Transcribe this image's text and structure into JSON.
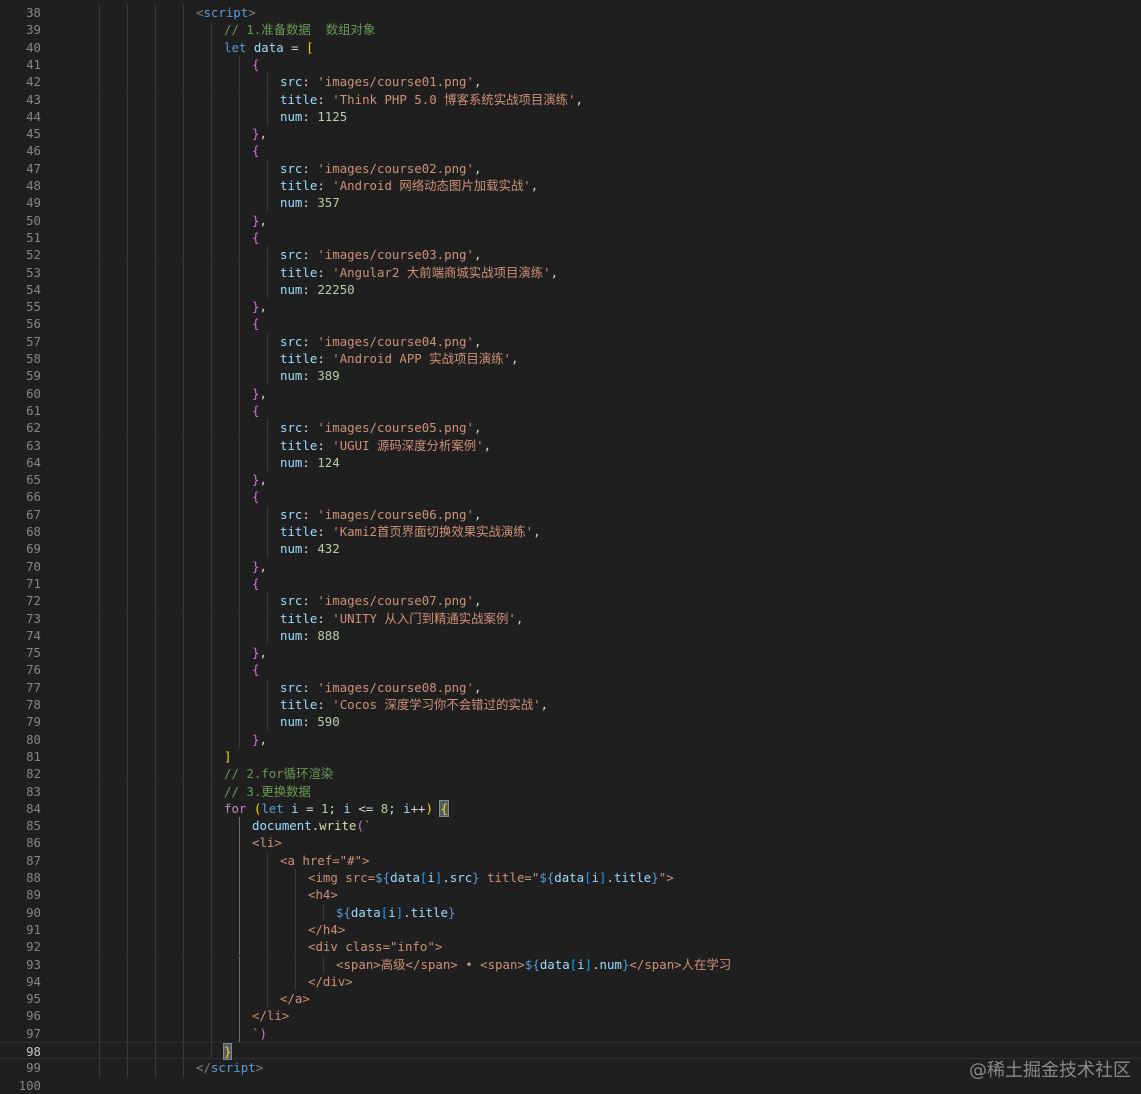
{
  "editor": {
    "lines": [
      {
        "num": "38",
        "indent": 4,
        "tokens": [
          [
            "tag",
            "<"
          ],
          [
            "tagname",
            "script"
          ],
          [
            "tag",
            ">"
          ]
        ]
      },
      {
        "num": "39",
        "indent": 5,
        "tokens": [
          [
            "cmt",
            "// 1.准备数据  数组对象"
          ]
        ]
      },
      {
        "num": "40",
        "indent": 5,
        "tokens": [
          [
            "kw",
            "let "
          ],
          [
            "var",
            "data"
          ],
          [
            "punc",
            " = "
          ],
          [
            "b1",
            "["
          ]
        ]
      },
      {
        "num": "41",
        "indent": 6,
        "tokens": [
          [
            "b2",
            "{"
          ]
        ]
      },
      {
        "num": "42",
        "indent": 7,
        "tokens": [
          [
            "prop",
            "src"
          ],
          [
            "punc",
            ": "
          ],
          [
            "str",
            "'images/course01.png'"
          ],
          [
            "punc",
            ","
          ]
        ]
      },
      {
        "num": "43",
        "indent": 7,
        "tokens": [
          [
            "prop",
            "title"
          ],
          [
            "punc",
            ": "
          ],
          [
            "str",
            "'Think PHP 5.0 博客系统实战项目演练'"
          ],
          [
            "punc",
            ","
          ]
        ]
      },
      {
        "num": "44",
        "indent": 7,
        "tokens": [
          [
            "prop",
            "num"
          ],
          [
            "punc",
            ": "
          ],
          [
            "num",
            "1125"
          ]
        ]
      },
      {
        "num": "45",
        "indent": 6,
        "tokens": [
          [
            "b2",
            "}"
          ],
          [
            "punc",
            ","
          ]
        ]
      },
      {
        "num": "46",
        "indent": 6,
        "tokens": [
          [
            "b2",
            "{"
          ]
        ]
      },
      {
        "num": "47",
        "indent": 7,
        "tokens": [
          [
            "prop",
            "src"
          ],
          [
            "punc",
            ": "
          ],
          [
            "str",
            "'images/course02.png'"
          ],
          [
            "punc",
            ","
          ]
        ]
      },
      {
        "num": "48",
        "indent": 7,
        "tokens": [
          [
            "prop",
            "title"
          ],
          [
            "punc",
            ": "
          ],
          [
            "str",
            "'Android 网络动态图片加载实战'"
          ],
          [
            "punc",
            ","
          ]
        ]
      },
      {
        "num": "49",
        "indent": 7,
        "tokens": [
          [
            "prop",
            "num"
          ],
          [
            "punc",
            ": "
          ],
          [
            "num",
            "357"
          ]
        ]
      },
      {
        "num": "50",
        "indent": 6,
        "tokens": [
          [
            "b2",
            "}"
          ],
          [
            "punc",
            ","
          ]
        ]
      },
      {
        "num": "51",
        "indent": 6,
        "tokens": [
          [
            "b2",
            "{"
          ]
        ]
      },
      {
        "num": "52",
        "indent": 7,
        "tokens": [
          [
            "prop",
            "src"
          ],
          [
            "punc",
            ": "
          ],
          [
            "str",
            "'images/course03.png'"
          ],
          [
            "punc",
            ","
          ]
        ]
      },
      {
        "num": "53",
        "indent": 7,
        "tokens": [
          [
            "prop",
            "title"
          ],
          [
            "punc",
            ": "
          ],
          [
            "str",
            "'Angular2 大前端商城实战项目演练'"
          ],
          [
            "punc",
            ","
          ]
        ]
      },
      {
        "num": "54",
        "indent": 7,
        "tokens": [
          [
            "prop",
            "num"
          ],
          [
            "punc",
            ": "
          ],
          [
            "num",
            "22250"
          ]
        ]
      },
      {
        "num": "55",
        "indent": 6,
        "tokens": [
          [
            "b2",
            "}"
          ],
          [
            "punc",
            ","
          ]
        ]
      },
      {
        "num": "56",
        "indent": 6,
        "tokens": [
          [
            "b2",
            "{"
          ]
        ]
      },
      {
        "num": "57",
        "indent": 7,
        "tokens": [
          [
            "prop",
            "src"
          ],
          [
            "punc",
            ": "
          ],
          [
            "str",
            "'images/course04.png'"
          ],
          [
            "punc",
            ","
          ]
        ]
      },
      {
        "num": "58",
        "indent": 7,
        "tokens": [
          [
            "prop",
            "title"
          ],
          [
            "punc",
            ": "
          ],
          [
            "str",
            "'Android APP 实战项目演练'"
          ],
          [
            "punc",
            ","
          ]
        ]
      },
      {
        "num": "59",
        "indent": 7,
        "tokens": [
          [
            "prop",
            "num"
          ],
          [
            "punc",
            ": "
          ],
          [
            "num",
            "389"
          ]
        ]
      },
      {
        "num": "60",
        "indent": 6,
        "tokens": [
          [
            "b2",
            "}"
          ],
          [
            "punc",
            ","
          ]
        ]
      },
      {
        "num": "61",
        "indent": 6,
        "tokens": [
          [
            "b2",
            "{"
          ]
        ]
      },
      {
        "num": "62",
        "indent": 7,
        "tokens": [
          [
            "prop",
            "src"
          ],
          [
            "punc",
            ": "
          ],
          [
            "str",
            "'images/course05.png'"
          ],
          [
            "punc",
            ","
          ]
        ]
      },
      {
        "num": "63",
        "indent": 7,
        "tokens": [
          [
            "prop",
            "title"
          ],
          [
            "punc",
            ": "
          ],
          [
            "str",
            "'UGUI 源码深度分析案例'"
          ],
          [
            "punc",
            ","
          ]
        ]
      },
      {
        "num": "64",
        "indent": 7,
        "tokens": [
          [
            "prop",
            "num"
          ],
          [
            "punc",
            ": "
          ],
          [
            "num",
            "124"
          ]
        ]
      },
      {
        "num": "65",
        "indent": 6,
        "tokens": [
          [
            "b2",
            "}"
          ],
          [
            "punc",
            ","
          ]
        ]
      },
      {
        "num": "66",
        "indent": 6,
        "tokens": [
          [
            "b2",
            "{"
          ]
        ]
      },
      {
        "num": "67",
        "indent": 7,
        "tokens": [
          [
            "prop",
            "src"
          ],
          [
            "punc",
            ": "
          ],
          [
            "str",
            "'images/course06.png'"
          ],
          [
            "punc",
            ","
          ]
        ]
      },
      {
        "num": "68",
        "indent": 7,
        "tokens": [
          [
            "prop",
            "title"
          ],
          [
            "punc",
            ": "
          ],
          [
            "str",
            "'Kami2首页界面切换效果实战演练'"
          ],
          [
            "punc",
            ","
          ]
        ]
      },
      {
        "num": "69",
        "indent": 7,
        "tokens": [
          [
            "prop",
            "num"
          ],
          [
            "punc",
            ": "
          ],
          [
            "num",
            "432"
          ]
        ]
      },
      {
        "num": "70",
        "indent": 6,
        "tokens": [
          [
            "b2",
            "}"
          ],
          [
            "punc",
            ","
          ]
        ]
      },
      {
        "num": "71",
        "indent": 6,
        "tokens": [
          [
            "b2",
            "{"
          ]
        ]
      },
      {
        "num": "72",
        "indent": 7,
        "tokens": [
          [
            "prop",
            "src"
          ],
          [
            "punc",
            ": "
          ],
          [
            "str",
            "'images/course07.png'"
          ],
          [
            "punc",
            ","
          ]
        ]
      },
      {
        "num": "73",
        "indent": 7,
        "tokens": [
          [
            "prop",
            "title"
          ],
          [
            "punc",
            ": "
          ],
          [
            "str",
            "'UNITY 从入门到精通实战案例'"
          ],
          [
            "punc",
            ","
          ]
        ]
      },
      {
        "num": "74",
        "indent": 7,
        "tokens": [
          [
            "prop",
            "num"
          ],
          [
            "punc",
            ": "
          ],
          [
            "num",
            "888"
          ]
        ]
      },
      {
        "num": "75",
        "indent": 6,
        "tokens": [
          [
            "b2",
            "}"
          ],
          [
            "punc",
            ","
          ]
        ]
      },
      {
        "num": "76",
        "indent": 6,
        "tokens": [
          [
            "b2",
            "{"
          ]
        ]
      },
      {
        "num": "77",
        "indent": 7,
        "tokens": [
          [
            "prop",
            "src"
          ],
          [
            "punc",
            ": "
          ],
          [
            "str",
            "'images/course08.png'"
          ],
          [
            "punc",
            ","
          ]
        ]
      },
      {
        "num": "78",
        "indent": 7,
        "tokens": [
          [
            "prop",
            "title"
          ],
          [
            "punc",
            ": "
          ],
          [
            "str",
            "'Cocos 深度学习你不会错过的实战'"
          ],
          [
            "punc",
            ","
          ]
        ]
      },
      {
        "num": "79",
        "indent": 7,
        "tokens": [
          [
            "prop",
            "num"
          ],
          [
            "punc",
            ": "
          ],
          [
            "num",
            "590"
          ]
        ]
      },
      {
        "num": "80",
        "indent": 6,
        "tokens": [
          [
            "b2",
            "}"
          ],
          [
            "punc",
            ","
          ]
        ]
      },
      {
        "num": "81",
        "indent": 5,
        "tokens": [
          [
            "b1",
            "]"
          ]
        ]
      },
      {
        "num": "82",
        "indent": 5,
        "tokens": [
          [
            "cmt",
            "// 2.for循环渲染"
          ]
        ]
      },
      {
        "num": "83",
        "indent": 5,
        "tokens": [
          [
            "cmt",
            "// 3.更换数据"
          ]
        ]
      },
      {
        "num": "84",
        "indent": 5,
        "tokens": [
          [
            "ctrl",
            "for "
          ],
          [
            "b1",
            "("
          ],
          [
            "kw",
            "let "
          ],
          [
            "var",
            "i"
          ],
          [
            "punc",
            " = "
          ],
          [
            "num",
            "1"
          ],
          [
            "punc",
            "; "
          ],
          [
            "var",
            "i"
          ],
          [
            "punc",
            " <= "
          ],
          [
            "num",
            "8"
          ],
          [
            "punc",
            "; "
          ],
          [
            "var",
            "i"
          ],
          [
            "punc",
            "++"
          ],
          [
            "b1",
            ")"
          ],
          [
            "punc",
            " "
          ],
          [
            "cursor",
            "{"
          ]
        ]
      },
      {
        "num": "85",
        "indent": 6,
        "tokens": [
          [
            "var",
            "document"
          ],
          [
            "punc",
            "."
          ],
          [
            "fn",
            "write"
          ],
          [
            "b2",
            "("
          ],
          [
            "tstr",
            "`"
          ]
        ]
      },
      {
        "num": "86",
        "indent": 6,
        "tokens": [
          [
            "tstr",
            "<li>"
          ]
        ]
      },
      {
        "num": "87",
        "indent": 7,
        "tokens": [
          [
            "tstr",
            "<a href=\"#\">"
          ]
        ]
      },
      {
        "num": "88",
        "indent": 8,
        "tokens": [
          [
            "tstr",
            "<img src="
          ],
          [
            "kw",
            "${"
          ],
          [
            "var",
            "data"
          ],
          [
            "b3",
            "["
          ],
          [
            "var",
            "i"
          ],
          [
            "b3",
            "]"
          ],
          [
            "punc",
            "."
          ],
          [
            "var",
            "src"
          ],
          [
            "kw",
            "}"
          ],
          [
            "tstr",
            " title=\""
          ],
          [
            "kw",
            "${"
          ],
          [
            "var",
            "data"
          ],
          [
            "b3",
            "["
          ],
          [
            "var",
            "i"
          ],
          [
            "b3",
            "]"
          ],
          [
            "punc",
            "."
          ],
          [
            "var",
            "title"
          ],
          [
            "kw",
            "}"
          ],
          [
            "tstr",
            "\">"
          ]
        ]
      },
      {
        "num": "89",
        "indent": 8,
        "tokens": [
          [
            "tstr",
            "<h4>"
          ]
        ]
      },
      {
        "num": "90",
        "indent": 9,
        "tokens": [
          [
            "kw",
            "${"
          ],
          [
            "var",
            "data"
          ],
          [
            "b3",
            "["
          ],
          [
            "var",
            "i"
          ],
          [
            "b3",
            "]"
          ],
          [
            "punc",
            "."
          ],
          [
            "var",
            "title"
          ],
          [
            "kw",
            "}"
          ]
        ]
      },
      {
        "num": "91",
        "indent": 8,
        "tokens": [
          [
            "tstr",
            "</h4>"
          ]
        ]
      },
      {
        "num": "92",
        "indent": 8,
        "tokens": [
          [
            "tstr",
            "<div class=\"info\">"
          ]
        ]
      },
      {
        "num": "93",
        "indent": 9,
        "tokens": [
          [
            "tstr",
            "<span>高级</span> • <span>"
          ],
          [
            "kw",
            "${"
          ],
          [
            "var",
            "data"
          ],
          [
            "b3",
            "["
          ],
          [
            "var",
            "i"
          ],
          [
            "b3",
            "]"
          ],
          [
            "punc",
            "."
          ],
          [
            "var",
            "num"
          ],
          [
            "kw",
            "}"
          ],
          [
            "tstr",
            "</span>人在学习"
          ]
        ]
      },
      {
        "num": "94",
        "indent": 8,
        "tokens": [
          [
            "tstr",
            "</div>"
          ]
        ]
      },
      {
        "num": "95",
        "indent": 7,
        "tokens": [
          [
            "tstr",
            "</a>"
          ]
        ]
      },
      {
        "num": "96",
        "indent": 6,
        "tokens": [
          [
            "tstr",
            "</li>"
          ]
        ]
      },
      {
        "num": "97",
        "indent": 6,
        "tokens": [
          [
            "tstr",
            "`"
          ],
          [
            "b2",
            ")"
          ]
        ]
      },
      {
        "num": "98",
        "indent": 5,
        "current": true,
        "tokens": [
          [
            "cursor",
            "}"
          ]
        ]
      },
      {
        "num": "99",
        "indent": 4,
        "tokens": [
          [
            "tag",
            "</"
          ],
          [
            "tagname",
            "script"
          ],
          [
            "tag",
            ">"
          ]
        ]
      },
      {
        "num": "100",
        "indent": 0,
        "tokens": []
      }
    ]
  },
  "watermark": "@稀土掘金技术社区"
}
